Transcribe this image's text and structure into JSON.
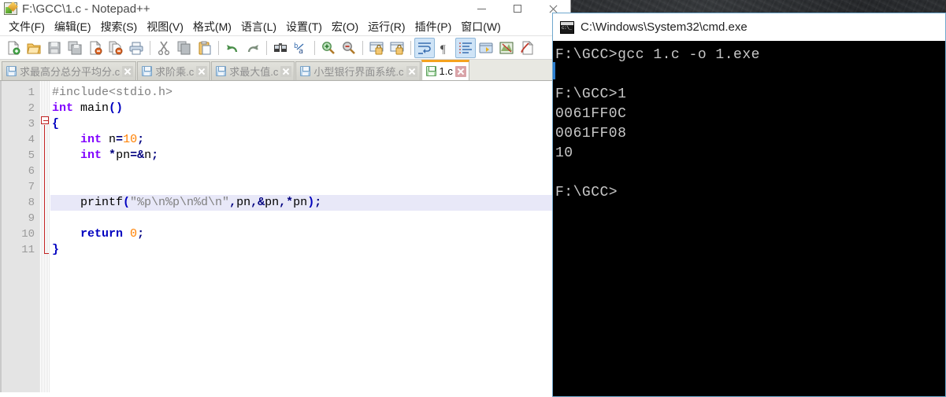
{
  "desktop": {
    "wallpaper_name": "rock-texture-wallpaper"
  },
  "notepadpp": {
    "title": "F:\\GCC\\1.c - Notepad++",
    "app_icon": "notepadpp-icon",
    "window_buttons": [
      {
        "name": "minimize-button",
        "glyph": "minimize-icon"
      },
      {
        "name": "maximize-button",
        "glyph": "maximize-icon"
      },
      {
        "name": "close-button",
        "glyph": "close-icon"
      }
    ],
    "menu": [
      "文件(F)",
      "编辑(E)",
      "搜索(S)",
      "视图(V)",
      "格式(M)",
      "语言(L)",
      "设置(T)",
      "宏(O)",
      "运行(R)",
      "插件(P)",
      "窗口(W)"
    ],
    "toolbar": [
      {
        "name": "new-file-icon",
        "active": false
      },
      {
        "name": "open-file-icon",
        "active": false
      },
      {
        "name": "save-icon",
        "active": false
      },
      {
        "name": "save-all-icon",
        "active": false
      },
      {
        "name": "close-file-icon",
        "active": false
      },
      {
        "name": "close-all-icon",
        "active": false
      },
      {
        "name": "print-icon",
        "active": false
      },
      {
        "name": "separator",
        "active": false
      },
      {
        "name": "cut-icon",
        "active": false
      },
      {
        "name": "copy-icon",
        "active": false
      },
      {
        "name": "paste-icon",
        "active": false
      },
      {
        "name": "separator",
        "active": false
      },
      {
        "name": "undo-icon",
        "active": false
      },
      {
        "name": "redo-icon",
        "active": false
      },
      {
        "name": "separator",
        "active": false
      },
      {
        "name": "find-icon",
        "active": false
      },
      {
        "name": "replace-icon",
        "active": false
      },
      {
        "name": "separator",
        "active": false
      },
      {
        "name": "zoom-in-icon",
        "active": false
      },
      {
        "name": "zoom-out-icon",
        "active": false
      },
      {
        "name": "separator",
        "active": false
      },
      {
        "name": "sync-vertical-scroll-icon",
        "active": false
      },
      {
        "name": "sync-horizontal-scroll-icon",
        "active": false
      },
      {
        "name": "separator",
        "active": false
      },
      {
        "name": "word-wrap-icon",
        "active": true
      },
      {
        "name": "show-all-characters-icon",
        "active": false
      },
      {
        "name": "indent-guide-icon",
        "active": true
      },
      {
        "name": "user-defined-dialog-icon",
        "active": false
      },
      {
        "name": "document-map-icon",
        "active": false
      },
      {
        "name": "function-list-icon",
        "active": false
      }
    ],
    "tabs": [
      {
        "label": "求最高分总分平均分.c",
        "active": false,
        "icon": "saved-file-icon"
      },
      {
        "label": "求阶乘.c",
        "active": false,
        "icon": "saved-file-icon"
      },
      {
        "label": "求最大值.c",
        "active": false,
        "icon": "saved-file-icon"
      },
      {
        "label": "小型银行界面系统.c",
        "active": false,
        "icon": "saved-file-icon"
      },
      {
        "label": "1.c",
        "active": true,
        "icon": "saved-file-icon"
      }
    ],
    "editor": {
      "line_numbers": [
        "1",
        "2",
        "3",
        "4",
        "5",
        "6",
        "7",
        "8",
        "9",
        "10",
        "11"
      ],
      "current_line": 8,
      "fold_marker_line": 3,
      "lines": [
        {
          "n": 1,
          "tokens": [
            {
              "t": "#include<stdio.h>",
              "c": "tk-pre"
            }
          ]
        },
        {
          "n": 2,
          "tokens": [
            {
              "t": "int",
              "c": "tk-kw"
            },
            {
              "t": " main",
              "c": "tk-fn"
            },
            {
              "t": "()",
              "c": "tk-br"
            }
          ]
        },
        {
          "n": 3,
          "tokens": [
            {
              "t": "{",
              "c": "tk-br"
            }
          ]
        },
        {
          "n": 4,
          "tokens": [
            {
              "t": "    ",
              "c": "tk-fn"
            },
            {
              "t": "int",
              "c": "tk-kw"
            },
            {
              "t": " n",
              "c": "tk-fn"
            },
            {
              "t": "=",
              "c": "tk-op"
            },
            {
              "t": "10",
              "c": "tk-num"
            },
            {
              "t": ";",
              "c": "tk-op"
            }
          ]
        },
        {
          "n": 5,
          "tokens": [
            {
              "t": "    ",
              "c": "tk-fn"
            },
            {
              "t": "int",
              "c": "tk-kw"
            },
            {
              "t": " ",
              "c": "tk-fn"
            },
            {
              "t": "*",
              "c": "tk-op"
            },
            {
              "t": "pn",
              "c": "tk-fn"
            },
            {
              "t": "=&",
              "c": "tk-op"
            },
            {
              "t": "n",
              "c": "tk-fn"
            },
            {
              "t": ";",
              "c": "tk-op"
            }
          ]
        },
        {
          "n": 6,
          "tokens": []
        },
        {
          "n": 7,
          "tokens": []
        },
        {
          "n": 8,
          "tokens": [
            {
              "t": "    printf",
              "c": "tk-fn"
            },
            {
              "t": "(",
              "c": "tk-br"
            },
            {
              "t": "\"%p\\n%p\\n%d\\n\"",
              "c": "tk-str"
            },
            {
              "t": ",",
              "c": "tk-op"
            },
            {
              "t": "pn",
              "c": "tk-fn"
            },
            {
              "t": ",",
              "c": "tk-op"
            },
            {
              "t": "&",
              "c": "tk-op"
            },
            {
              "t": "pn",
              "c": "tk-fn"
            },
            {
              "t": ",",
              "c": "tk-op"
            },
            {
              "t": "*",
              "c": "tk-op"
            },
            {
              "t": "pn",
              "c": "tk-fn"
            },
            {
              "t": ")",
              "c": "tk-br"
            },
            {
              "t": ";",
              "c": "tk-op"
            }
          ]
        },
        {
          "n": 9,
          "tokens": []
        },
        {
          "n": 10,
          "tokens": [
            {
              "t": "    ",
              "c": "tk-fn"
            },
            {
              "t": "return",
              "c": "tk-kw2"
            },
            {
              "t": " ",
              "c": "tk-fn"
            },
            {
              "t": "0",
              "c": "tk-num"
            },
            {
              "t": ";",
              "c": "tk-op"
            }
          ]
        },
        {
          "n": 11,
          "tokens": [
            {
              "t": "}",
              "c": "tk-br"
            }
          ]
        }
      ]
    }
  },
  "cmd": {
    "title": "C:\\Windows\\System32\\cmd.exe",
    "icon": "cmd-console-icon",
    "lines": [
      "F:\\GCC>gcc 1.c -o 1.exe",
      "",
      "F:\\GCC>1",
      "0061FF0C",
      "0061FF08",
      "10",
      "",
      "F:\\GCC>"
    ]
  },
  "colors": {
    "accent_tab": "#f5a21e",
    "cmd_border": "#6fa8cd",
    "current_line": "#e8e8f8",
    "gutter": "#e4e4e4",
    "keyword": "#8000ff",
    "number": "#ff8000",
    "string": "#808080",
    "return_keyword": "#0000c0"
  }
}
